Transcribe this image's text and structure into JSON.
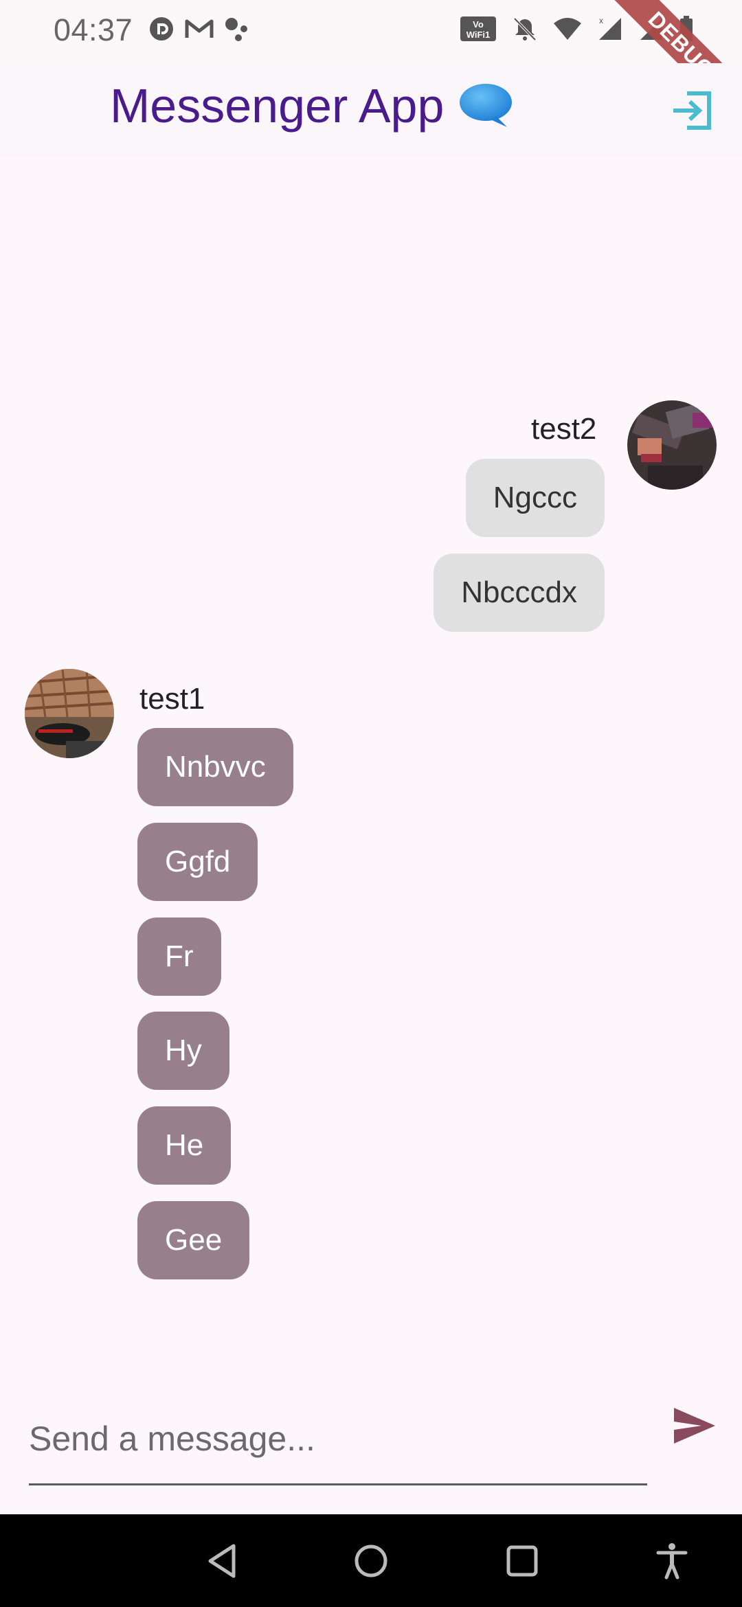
{
  "status_bar": {
    "time": "04:37",
    "debug_label": "DEBUG"
  },
  "app_bar": {
    "title": "Messenger App",
    "title_icon": "chat-bubble-icon",
    "logout_icon": "logout-icon"
  },
  "messages": {
    "outgoing": {
      "sender": "test2",
      "bubbles": [
        "Ngccc",
        "Nbcccdx"
      ]
    },
    "incoming": {
      "sender": "test1",
      "bubbles": [
        "Nnbvvc",
        "Ggfd",
        "Fr",
        "Hy",
        "He",
        "Gee"
      ]
    }
  },
  "composer": {
    "placeholder": "Send a message...",
    "value": "",
    "send_icon": "send-icon"
  },
  "colors": {
    "title": "#4a1b8c",
    "outgoing_bubble": "#e0e0e0",
    "incoming_bubble": "#98808a",
    "send_icon": "#8a4a5e",
    "logout_icon": "#4bbcd0"
  }
}
